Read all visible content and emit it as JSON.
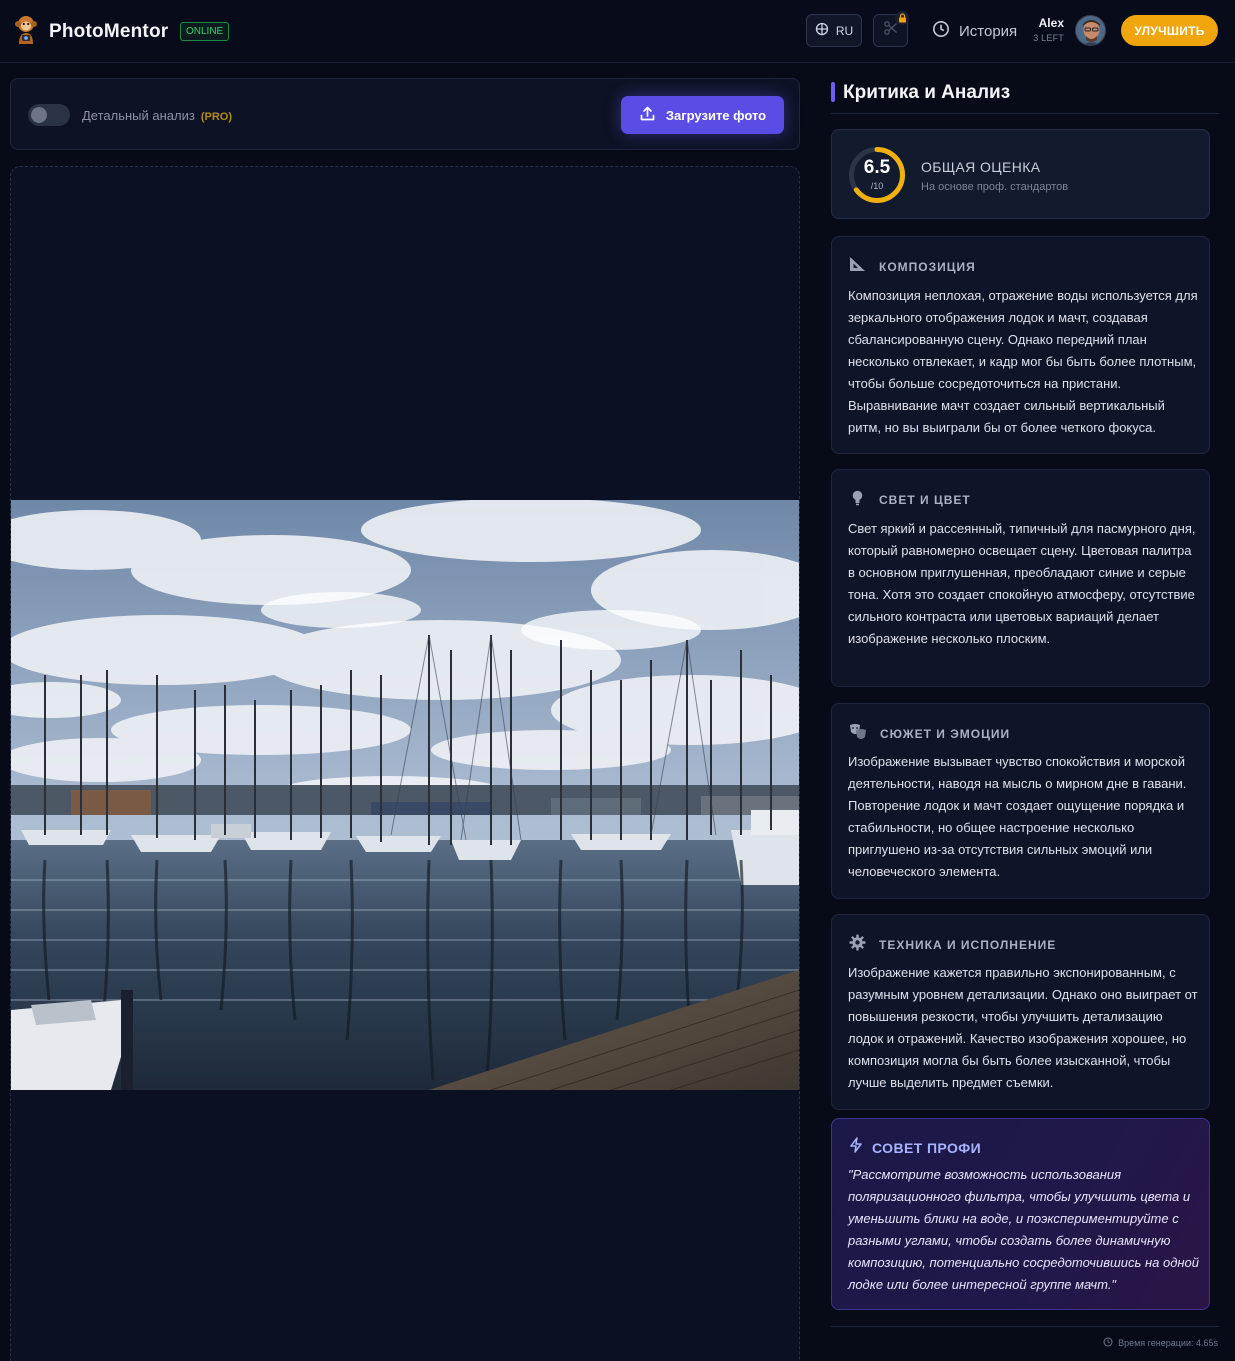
{
  "header": {
    "brand": "PhotoMentor",
    "status_badge": "ONLINE",
    "language": "RU",
    "history_label": "История",
    "user_name": "Alex",
    "credits_left": "3 LEFT",
    "upgrade_label": "УЛУЧШИТЬ"
  },
  "controls": {
    "toggle_label": "Детальный анализ",
    "pro_tag": "(PRO)",
    "toggle_on": false,
    "upload_label": "Загрузите фото"
  },
  "panel": {
    "title": "Критика и Анализ",
    "score": {
      "value": "6.5",
      "max": "/10",
      "value_number": 6.5,
      "max_number": 10,
      "title": "ОБЩАЯ ОЦЕНКА",
      "subtitle": "На основе проф. стандартов"
    },
    "sections": [
      {
        "icon": "ruler-triangle-icon",
        "title": "КОМПОЗИЦИЯ",
        "text": "Композиция неплохая, отражение воды используется для зеркального отображения лодок и мачт, создавая сбалансированную сцену. Однако передний план несколько отвлекает, и кадр мог бы быть более плотным, чтобы больше сосредоточиться на пристани. Выравнивание мачт создает сильный вертикальный ритм, но вы выиграли бы от более четкого фокуса."
      },
      {
        "icon": "lightbulb-icon",
        "title": "СВЕТ И ЦВЕТ",
        "text": "Свет яркий и рассеянный, типичный для пасмурного дня, который равномерно освещает сцену. Цветовая палитра в основном приглушенная, преобладают синие и серые тона. Хотя это создает спокойную атмосферу, отсутствие сильного контраста или цветовых вариаций делает изображение несколько плоским."
      },
      {
        "icon": "theater-masks-icon",
        "title": "СЮЖЕТ И ЭМОЦИИ",
        "text": "Изображение вызывает чувство спокойствия и морской деятельности, наводя на мысль о мирном дне в гавани. Повторение лодок и мачт создает ощущение порядка и стабильности, но общее настроение несколько приглушено из-за отсутствия сильных эмоций или человеческого элемента."
      },
      {
        "icon": "gear-icon",
        "title": "ТЕХНИКА И ИСПОЛНЕНИЕ",
        "text": "Изображение кажется правильно экспонированным, с разумным уровнем детализации. Однако оно выиграет от повышения резкости, чтобы улучшить детализацию лодок и отражений. Качество изображения хорошее, но композиция могла бы быть более изысканной, чтобы лучше выделить предмет съемки."
      }
    ],
    "pro_tip": {
      "title": "СОВЕТ ПРОФИ",
      "text": "\"Рассмотрите возможность использования поляризационного фильтра, чтобы улучшить цвета и уменьшить блики на воде, и поэкспериментируйте с разными углами, чтобы создать более динамичную композицию, потенциально сосредоточившись на одной лодке или более интересной группе мачт.\""
    },
    "generation_time": "Время генерации: 4.65s"
  },
  "colors": {
    "accent": "#5a4de6",
    "upgrade": "#f0a50c",
    "score_ring": "#f2b010",
    "online": "#3ecb6f",
    "pro": "#b58a1f",
    "background": "#070b18"
  }
}
